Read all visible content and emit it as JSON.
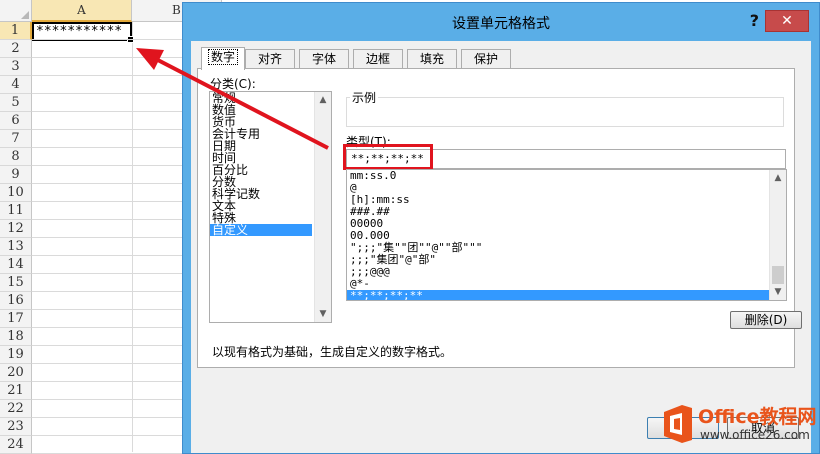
{
  "sheet": {
    "columns": [
      "A",
      "B"
    ],
    "rows": [
      "1",
      "2",
      "3",
      "4",
      "5",
      "6",
      "7",
      "8",
      "9",
      "10",
      "11",
      "12",
      "13",
      "14",
      "15",
      "16",
      "17",
      "18",
      "19",
      "20",
      "21",
      "22",
      "23",
      "24"
    ],
    "cell_a1": "***********"
  },
  "dialog": {
    "title": "设置单元格格式",
    "help": "?",
    "close": "✕",
    "tabs": [
      "数字",
      "对齐",
      "字体",
      "边框",
      "填充",
      "保护"
    ],
    "category_label": "分类(C):",
    "categories": [
      "常规",
      "数值",
      "货币",
      "会计专用",
      "日期",
      "时间",
      "百分比",
      "分数",
      "科学记数",
      "文本",
      "特殊",
      "自定义"
    ],
    "selected_category": "自定义",
    "sample_label": "示例",
    "type_label": "类型(T):",
    "type_value": "**;**;**;**",
    "formats": [
      "mm:ss.0",
      "@",
      "[h]:mm:ss",
      "###.##",
      "00000",
      "00.000",
      "\";;;\"集\"\"团\"\"@\"\"部\"\"\"",
      ";;;\"集团\"@\"部\"",
      ";;;@@@",
      "@*-",
      "**;**;**;**"
    ],
    "selected_format": "**;**;**;**",
    "delete_button": "删除(D)",
    "description": "以现有格式为基础，生成自定义的数字格式。",
    "cancel_button": "取消"
  },
  "watermark": {
    "name": "Office教程网",
    "url": "www.office26.com"
  },
  "colors": {
    "dialog_frame": "#5aaee7",
    "selection": "#3399ff",
    "highlight_red": "#e0141e",
    "close_red": "#c74b4b",
    "brand_orange": "#e9541b"
  }
}
